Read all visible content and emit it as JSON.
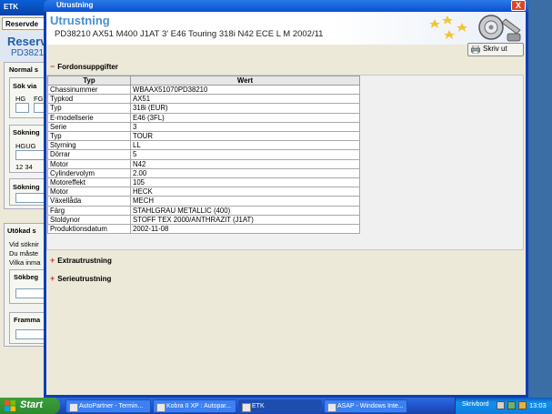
{
  "background_window": {
    "title": "ETK",
    "tab": "Reservde",
    "header_title": "Reserv",
    "header_sub": "PD3821",
    "section_normal": "Normal s",
    "sok_via": "Sök via",
    "hg": "HG",
    "fg": "FG",
    "sokning1": "Sökning",
    "hgug": "HGUG",
    "code": "12 34",
    "sokning2": "Sökning",
    "utokad": "Utökad s",
    "vid": "Vid söknir",
    "du": "Du måste",
    "vilka": "Vilka inma",
    "sokbeg": "Sökbeg",
    "framma": "Framma"
  },
  "window": {
    "title": "Utrustning",
    "close_label": "X"
  },
  "header": {
    "title": "Utrustning",
    "subtitle": "PD38210 AX51 M400 J1AT 3' E46 Touring 318i N42 ECE L M 2002/11"
  },
  "toolbar": {
    "print_label": "Skriv ut"
  },
  "sections": {
    "fordon": "Fordonsuppgifter",
    "extra": "Extrautrustning",
    "serie": "Serieutrustning"
  },
  "table": {
    "columns": [
      "Typ",
      "Wert"
    ],
    "rows": [
      [
        "Chassinummer",
        "WBAAX51070PD38210"
      ],
      [
        "Typkod",
        "AX51"
      ],
      [
        "Typ",
        "318i (EUR)"
      ],
      [
        "E-modellserie",
        "E46 (3FL)"
      ],
      [
        "Serie",
        "3"
      ],
      [
        "Typ",
        "TOUR"
      ],
      [
        "Styrning",
        "LL"
      ],
      [
        "Dörrar",
        "5"
      ],
      [
        "Motor",
        "N42"
      ],
      [
        "Cylindervolym",
        "2.00"
      ],
      [
        "Motoreffekt",
        "105"
      ],
      [
        "Motor",
        "HECK"
      ],
      [
        "Växellåda",
        "MECH"
      ],
      [
        "Färg",
        "STAHLGRAU METALLIC (400)"
      ],
      [
        "Stoldynor",
        "STOFF TEX 2000/ANTHRAZIT (J1AT)"
      ],
      [
        "Produktionsdatum",
        "2002-11-08"
      ]
    ]
  },
  "taskbar": {
    "start_label": "Start",
    "items": [
      {
        "label": "AutoPartner - Termin..."
      },
      {
        "label": "Kobra II XP : Autopar..."
      },
      {
        "label": "ETK"
      },
      {
        "label": "ASAP - Windows Inte..."
      }
    ],
    "tray_label": "Skrivbord",
    "clock": "13:03"
  }
}
